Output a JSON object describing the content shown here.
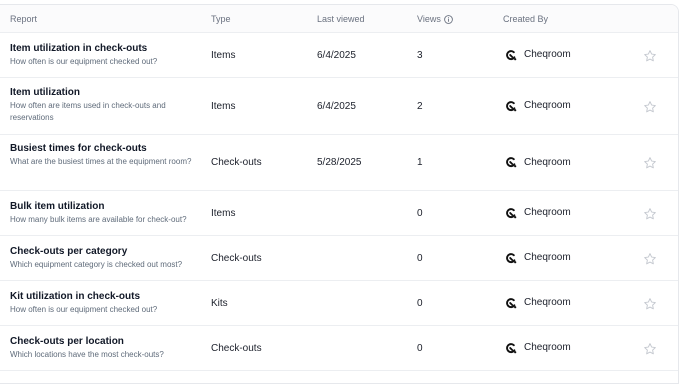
{
  "columns": {
    "report": "Report",
    "type": "Type",
    "last_viewed": "Last viewed",
    "views": "Views",
    "created_by": "Created By"
  },
  "rows": [
    {
      "title": "Item utilization in check-outs",
      "desc": "How often is our equipment checked out?",
      "type": "Items",
      "last_viewed": "6/4/2025",
      "views": "3",
      "creator": "Cheqroom"
    },
    {
      "title": "Item utilization",
      "desc": "How often are items used in check-outs and reservations",
      "type": "Items",
      "last_viewed": "6/4/2025",
      "views": "2",
      "creator": "Cheqroom"
    },
    {
      "title": "Busiest times for check-outs",
      "desc": "What are the busiest times at the equipment room?",
      "type": "Check-outs",
      "last_viewed": "5/28/2025",
      "views": "1",
      "creator": "Cheqroom"
    },
    {
      "title": "Bulk item utilization",
      "desc": "How many bulk items are available for check-out?",
      "type": "Items",
      "last_viewed": "",
      "views": "0",
      "creator": "Cheqroom"
    },
    {
      "title": "Check-outs per category",
      "desc": "Which equipment category is checked out most?",
      "type": "Check-outs",
      "last_viewed": "",
      "views": "0",
      "creator": "Cheqroom"
    },
    {
      "title": "Kit utilization in check-outs",
      "desc": "How often is our equipment checked out?",
      "type": "Kits",
      "last_viewed": "",
      "views": "0",
      "creator": "Cheqroom"
    },
    {
      "title": "Check-outs per location",
      "desc": "Which locations have the most check-outs?",
      "type": "Check-outs",
      "last_viewed": "",
      "views": "0",
      "creator": "Cheqroom"
    }
  ],
  "icons": {
    "info": "info-icon",
    "creator_logo": "cheqroom-logo-icon",
    "favorite": "star-outline-icon"
  },
  "colors": {
    "header_text": "#6b7280",
    "desc_text": "#5f6b7a",
    "star_stroke": "#c4c8cf"
  }
}
